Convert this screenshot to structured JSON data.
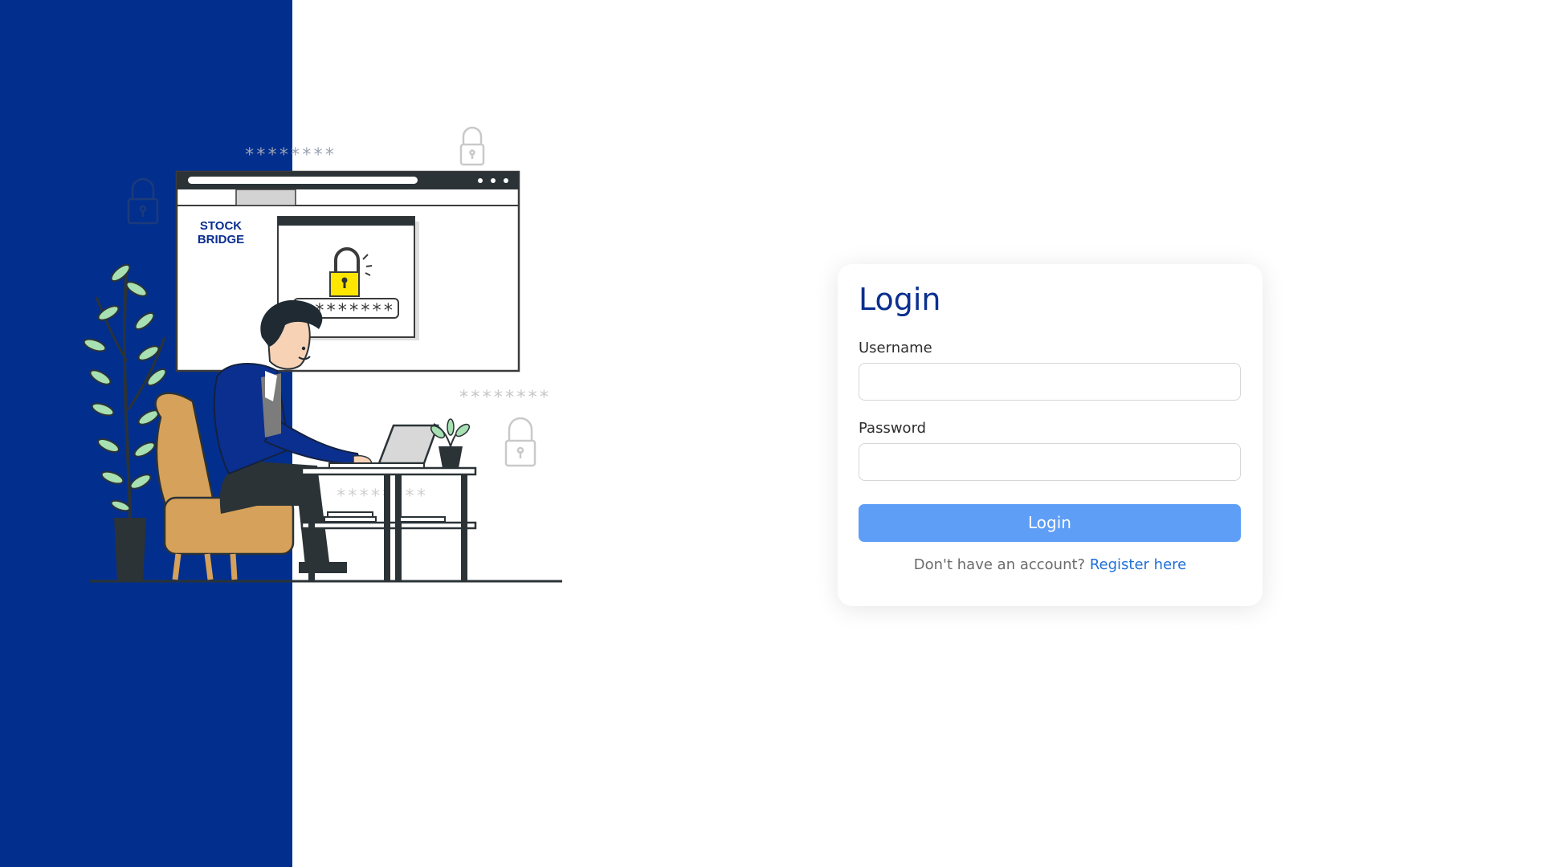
{
  "illustration": {
    "brand_line1": "STOCK",
    "brand_line2": "BRIDGE",
    "password_mask": "********",
    "floating_mask": "********"
  },
  "login": {
    "title": "Login",
    "username_label": "Username",
    "username_value": "",
    "password_label": "Password",
    "password_value": "",
    "submit_label": "Login",
    "register_prompt": "Don't have an account?",
    "register_link": "Register here"
  },
  "colors": {
    "brand_blue": "#022f8e",
    "button": "#5e9ef6",
    "link": "#1f6fd6",
    "title": "#0b2f8f"
  }
}
